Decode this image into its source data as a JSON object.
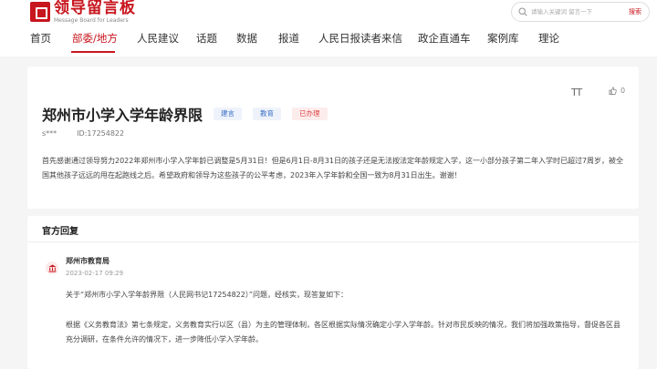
{
  "header": {
    "logo_cn": "领导留言板",
    "logo_en": "Message Board for Leaders",
    "search_placeholder": "请输入关键词 留言一下",
    "search_button": "搜索"
  },
  "nav": {
    "items": [
      "首页",
      "部委/地方",
      "人民建议",
      "话题",
      "数据",
      "报道",
      "人民日报读者来信",
      "政企直通车",
      "案例库",
      "理论"
    ],
    "active_index": 1
  },
  "message": {
    "font_toggle": "TT",
    "like_count": "0",
    "title": "郑州市小学入学年龄界限",
    "tags": [
      "建言",
      "教育",
      "已办理"
    ],
    "author": "s***",
    "id": "ID:17254822",
    "content": "首先感谢通过领导努力2022年郑州市小学入学年龄已调整是5月31日！但是6月1日-8月31日的孩子还是无法按法定年龄规定入学，这一小部分孩子第二年入学时已超过7周岁，被全国其他孩子远远的甩在起跑线之后。希望政府和领导为这些孩子的公平考虑，2023年入学年龄和全国一致为8月31日出生。谢谢！"
  },
  "reply": {
    "heading": "官方回复",
    "org": "郑州市教育局",
    "date": "2023-02-17 09:29",
    "para1": "关于“郑州市小学入学年龄界限（人民网书记17254822）”问题，经核实，现答复如下：",
    "para2": "根据《义务教育法》第七条规定，义务教育实行以区（县）为主的管理体制，各区根据实际情况确定小学入学年龄。针对市民反映的情况，我们将加强政策指导，督促各区县充分调研，在条件允许的情况下，进一步降低小学入学年龄。"
  },
  "colors": {
    "brand_red": "#c8161e",
    "tag_blue": "#3b6fc4",
    "tag_red": "#e04646"
  }
}
